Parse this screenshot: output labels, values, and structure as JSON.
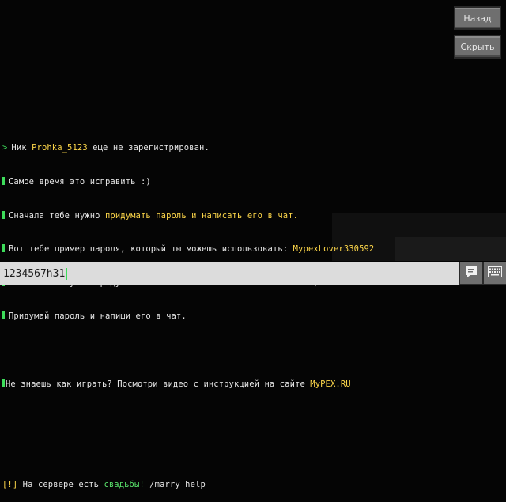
{
  "side_buttons": {
    "back": "Назад",
    "hide": "Скрыть"
  },
  "chat": {
    "l1_name_prefix": "Ник ",
    "l1_name": "Prohka_5123",
    "l1_suffix": " еще не зарегистрирован.",
    "l2": "Самое время это исправить :)",
    "l3_pre": "Сначала тебе нужно ",
    "l3_hl": "придумать пароль и написать его в чат.",
    "l4_pre": "Вот тебе пример пароля, который ты можешь использовать: ",
    "l4_hl": "MypexLover330592",
    "l5_pre": "Но конечно лучше придумай свой. Это может быть ",
    "l5_hl": "любое слово",
    "l5_post": " :)",
    "l6": "Придумай пароль и напиши его в чат.",
    "l7_pre": "Не знаешь как играть? Посмотри видео с инструкцией на сайте ",
    "l7_hl": "MyPEX.RU",
    "l8_tag": "[!]",
    "l8_pre": " На сервере есть ",
    "l8_hl": "свадьбы!",
    "l8_post": " /marry help",
    "arrow": ">"
  },
  "input": {
    "value": "1234567h31"
  },
  "icons": {
    "send": "chat-send-icon",
    "keyboard": "keyboard-icon"
  },
  "colors": {
    "accent_green": "#3ddc5a",
    "highlight_yellow": "#ffd84a",
    "highlight_red": "#ff4b4b"
  }
}
